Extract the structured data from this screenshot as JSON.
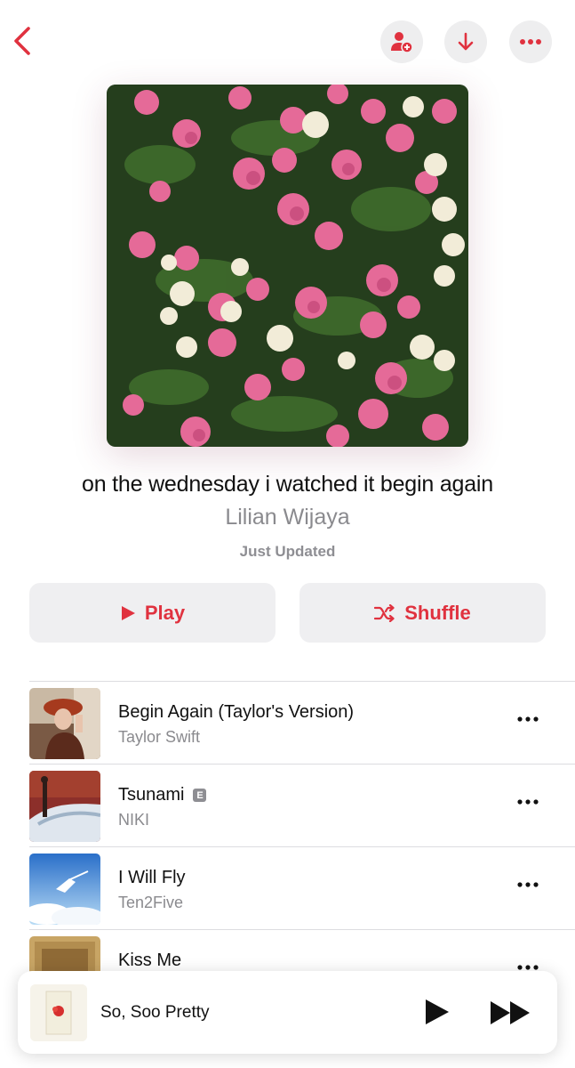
{
  "header": {
    "back_icon": "chevron-left-icon",
    "add_user_icon": "person-add-icon",
    "download_icon": "arrow-down-icon",
    "more_icon": "ellipsis-icon"
  },
  "playlist": {
    "title": "on the wednesday i watched it begin again",
    "curator": "Lilian Wijaya",
    "updated": "Just Updated"
  },
  "actions": {
    "play_label": "Play",
    "shuffle_label": "Shuffle"
  },
  "tracks": [
    {
      "title": "Begin Again (Taylor's Version)",
      "artist": "Taylor Swift",
      "explicit": false
    },
    {
      "title": "Tsunami",
      "artist": "NIKI",
      "explicit": true,
      "explicit_label": "E"
    },
    {
      "title": "I Will Fly",
      "artist": "Ten2Five",
      "explicit": false
    },
    {
      "title": "Kiss Me",
      "artist": "",
      "explicit": false
    }
  ],
  "mini_player": {
    "title": "So, Soo Pretty"
  },
  "colors": {
    "accent": "#e0323f",
    "secondary_text": "#8a8a8e",
    "button_bg": "#efeff1"
  }
}
